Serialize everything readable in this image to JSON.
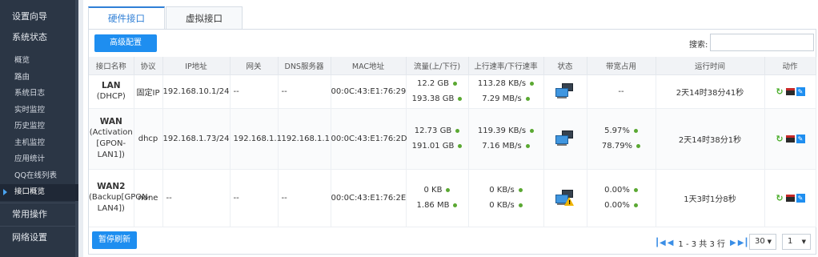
{
  "sidebar": {
    "top_items": [
      "设置向导",
      "系统状态"
    ],
    "sub_items": [
      "概览",
      "路由",
      "系统日志",
      "实时监控",
      "历史监控",
      "主机监控",
      "应用统计",
      "QQ在线列表",
      "接口概览"
    ],
    "active_sub": "接口概览",
    "bottom_items": [
      "常用操作",
      "网络设置"
    ]
  },
  "tabs": [
    "硬件接口",
    "虚拟接口"
  ],
  "toolbar": {
    "advanced_button": "高级配置",
    "search_label": "搜索:",
    "search_value": ""
  },
  "table": {
    "headers": [
      "接口名称",
      "协议",
      "IP地址",
      "网关",
      "DNS服务器",
      "MAC地址",
      "流量(上/下行)",
      "上行速率/下行速率",
      "状态",
      "带宽占用",
      "运行时间",
      "动作"
    ],
    "rows": [
      {
        "name": "LAN",
        "name_sub": "(DHCP)",
        "protocol": "固定IP",
        "ip": "192.168.10.1/24",
        "gateway": "--",
        "dns": "--",
        "mac": "00:0C:43:E1:76:29",
        "traffic_up": "12.2 GB",
        "traffic_down": "193.38 GB",
        "rate_up": "113.28 KB/s",
        "rate_down": "7.29 MB/s",
        "status": "connected",
        "bw": "--",
        "bw2": "",
        "uptime": "2天14时38分41秒"
      },
      {
        "name": "WAN",
        "name_sub": "(Activation [GPON-LAN1])",
        "protocol": "dhcp",
        "ip": "192.168.1.73/24",
        "gateway": "192.168.1.1",
        "dns": "192.168.1.1",
        "mac": "00:0C:43:E1:76:2D",
        "traffic_up": "12.73 GB",
        "traffic_down": "191.01 GB",
        "rate_up": "119.39 KB/s",
        "rate_down": "7.16 MB/s",
        "status": "connected",
        "bw": "5.97%",
        "bw2": "78.79%",
        "uptime": "2天14时38分1秒"
      },
      {
        "name": "WAN2",
        "name_sub": "(Backup[GPON-LAN4])",
        "protocol": "none",
        "ip": "--",
        "gateway": "--",
        "dns": "--",
        "mac": "00:0C:43:E1:76:2E",
        "traffic_up": "0 KB",
        "traffic_down": "1.86 MB",
        "rate_up": "0 KB/s",
        "rate_down": "0 KB/s",
        "status": "warning",
        "bw": "0.00%",
        "bw2": "0.00%",
        "uptime": "1天3时1分8秒"
      }
    ]
  },
  "footer": {
    "pause_button": "暂停刷新",
    "page_info": "1 - 3 共 3 行",
    "page_size": "30",
    "page_number": "1"
  }
}
